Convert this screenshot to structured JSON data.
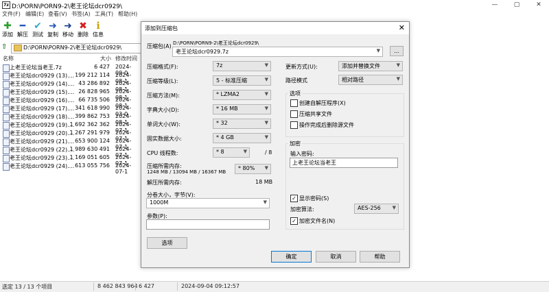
{
  "window": {
    "title": "D:\\PORN\\PORN9-2\\老王论坛dcr0929\\",
    "app_icon": "7z",
    "controls": {
      "minimize": "—",
      "maximize": "▢",
      "close": "✕"
    }
  },
  "menu": [
    "文件(F)",
    "编辑(E)",
    "查看(V)",
    "书签(A)",
    "工具(T)",
    "帮助(H)"
  ],
  "toolbar": [
    {
      "label": "添加",
      "icon": "plus-icon",
      "glyph": "✚",
      "color": "#2e9e2e"
    },
    {
      "label": "解压",
      "icon": "minus-icon",
      "glyph": "━",
      "color": "#2455b8"
    },
    {
      "label": "测试",
      "icon": "check-icon",
      "glyph": "✔",
      "color": "#3aa8c8"
    },
    {
      "label": "复制",
      "icon": "copy-arrow-icon",
      "glyph": "➜",
      "color": "#2455b8"
    },
    {
      "label": "移动",
      "icon": "move-arrow-icon",
      "glyph": "➜",
      "color": "#1a3f8f"
    },
    {
      "label": "删除",
      "icon": "delete-icon",
      "glyph": "✖",
      "color": "#d21f1f"
    },
    {
      "label": "信息",
      "icon": "info-icon",
      "glyph": "ℹ",
      "color": "#c8a000"
    }
  ],
  "address": {
    "path": "D:\\PORN\\PORN9-2\\老王论坛dcr0929\\"
  },
  "file_list": {
    "columns": [
      "名称",
      "大小",
      "修改时间"
    ],
    "rows": [
      {
        "name": "上老王论坛当老王.7z",
        "size": "6 427",
        "date": "2024-09-0"
      },
      {
        "name": "老王论坛dcr0929 (13)....",
        "size": "199 212 114",
        "date": "2024-08-1"
      },
      {
        "name": "老王论坛dcr0929 (14)....",
        "size": "43 286 892",
        "date": "2024-08-1"
      },
      {
        "name": "老王论坛dcr0929 (15)....",
        "size": "26 828 965",
        "date": "2024-08-1"
      },
      {
        "name": "老王论坛dcr0929 (16)....",
        "size": "66 735 506",
        "date": "2024-08-1"
      },
      {
        "name": "老王论坛dcr0929 (17)....",
        "size": "341 618 990",
        "date": "2024-03-0"
      },
      {
        "name": "老王论坛dcr0929 (18)....",
        "size": "399 862 753",
        "date": "2024-08-1"
      },
      {
        "name": "老王论坛dcr0929 (19)....",
        "size": "1 692 362 362",
        "date": "2024-07-1"
      },
      {
        "name": "老王论坛dcr0929 (20)....",
        "size": "1 267 291 979",
        "date": "2024-07-1"
      },
      {
        "name": "老王论坛dcr0929 (21)....",
        "size": "653 900 124",
        "date": "2024-07-1"
      },
      {
        "name": "老王论坛dcr0929 (22)....",
        "size": "1 989 630 491",
        "date": "2024-07-1"
      },
      {
        "name": "老王论坛dcr0929 (23)....",
        "size": "1 169 051 605",
        "date": "2024-07-1"
      },
      {
        "name": "老王论坛dcr0929 (24)....",
        "size": "613 055 756",
        "date": "2024-07-1"
      }
    ]
  },
  "status": {
    "selection": "选定 13 / 13 个项目",
    "total_size": "8 462 843 964",
    "selected_size": "6 427",
    "modified": "2024-09-04 09:12:57"
  },
  "dialog": {
    "title": "添加到压缩包",
    "close": "✕",
    "archive_label": "压缩包(A)",
    "archive_dir": "D:\\PORN\\PORN9-2\\老王论坛dcr0929\\",
    "archive_name": "老王论坛dcr0929.7z",
    "browse_label": "...",
    "format_label": "压缩格式(F):",
    "format_value": "7z",
    "level_label": "压缩等级(L):",
    "level_value": "5 - 标准压缩",
    "method_label": "压缩方法(M):",
    "method_value": "* LZMA2",
    "dict_label": "字典大小(D):",
    "dict_value": "* 16 MB",
    "word_label": "单词大小(W):",
    "word_value": "* 32",
    "solid_label": "固实数据大小:",
    "solid_value": "* 4 GB",
    "threads_label": "CPU 线程数:",
    "threads_value": "* 8",
    "threads_total": "/ 8",
    "mem_label": "压缩所需内存:",
    "mem_detail": "1248 MB / 13094 MB / 16367 MB",
    "mem_percent": "* 80%",
    "decomp_label": "解压所需内存:",
    "decomp_value": "18 MB",
    "split_label": "分卷大小，字节(V):",
    "split_value": "1000M",
    "params_label": "参数(P):",
    "params_value": "",
    "options_button": "选项",
    "update_label": "更新方式(U):",
    "update_value": "添加并替换文件",
    "pathmode_label": "路径模式",
    "pathmode_value": "相对路径",
    "options_group": "选项",
    "opt_sfx": "创建自解压程序(X)",
    "opt_shared": "压缩共享文件",
    "opt_delete": "操作完成后删除源文件",
    "encrypt_group": "加密",
    "password_label": "输入密码:",
    "password_value": "上老王论坛当老王",
    "show_password": "显示密码(S)",
    "enc_method_label": "加密算法:",
    "enc_method_value": "AES-256",
    "enc_names": "加密文件名(N)",
    "ok": "确定",
    "cancel": "取消",
    "help": "帮助"
  }
}
